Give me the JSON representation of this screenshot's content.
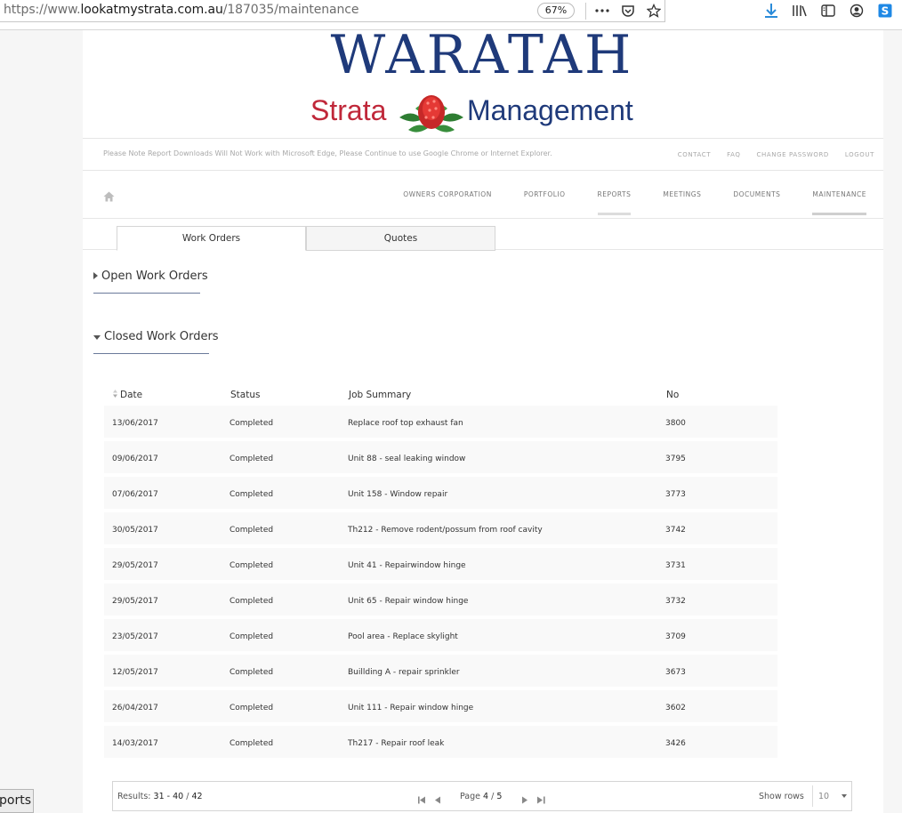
{
  "browser": {
    "url_prefix": "https://www.",
    "url_host": "lookatmystrata.com.au",
    "url_path": "/187035/maintenance",
    "zoom": "67%"
  },
  "logo": {
    "line1": "WARATAH",
    "line2a": "Strata",
    "line2b": "Management"
  },
  "notice": "Please Note Report Downloads Will Not Work with Microsoft Edge, Please Continue to use Google Chrome or Internet Explorer.",
  "toplinks": [
    "CONTACT",
    "FAQ",
    "CHANGE PASSWORD",
    "LOGOUT"
  ],
  "mainnav": [
    "OWNERS CORPORATION",
    "PORTFOLIO",
    "REPORTS",
    "MEETINGS",
    "DOCUMENTS",
    "MAINTENANCE"
  ],
  "tabs": {
    "work": "Work Orders",
    "quotes": "Quotes"
  },
  "sections": {
    "open": "Open Work Orders",
    "closed": "Closed Work Orders"
  },
  "table": {
    "headers": {
      "date": "Date",
      "status": "Status",
      "summary": "Job Summary",
      "no": "No"
    },
    "rows": [
      {
        "date": "13/06/2017",
        "status": "Completed",
        "summary": "Replace roof top exhaust fan",
        "no": "3800"
      },
      {
        "date": "09/06/2017",
        "status": "Completed",
        "summary": "Unit 88 - seal leaking window",
        "no": "3795"
      },
      {
        "date": "07/06/2017",
        "status": "Completed",
        "summary": "Unit 158 - Window repair",
        "no": "3773"
      },
      {
        "date": "30/05/2017",
        "status": "Completed",
        "summary": "Th212 - Remove rodent/possum from roof cavity",
        "no": "3742"
      },
      {
        "date": "29/05/2017",
        "status": "Completed",
        "summary": "Unit 41 - Repairwindow hinge",
        "no": "3731"
      },
      {
        "date": "29/05/2017",
        "status": "Completed",
        "summary": "Unit 65 - Repair window hinge",
        "no": "3732"
      },
      {
        "date": "23/05/2017",
        "status": "Completed",
        "summary": "Pool area - Replace skylight",
        "no": "3709"
      },
      {
        "date": "12/05/2017",
        "status": "Completed",
        "summary": "Buillding A - repair sprinkler",
        "no": "3673"
      },
      {
        "date": "26/04/2017",
        "status": "Completed",
        "summary": "Unit 111 - Repair window hinge",
        "no": "3602"
      },
      {
        "date": "14/03/2017",
        "status": "Completed",
        "summary": "Th217 - Repair roof leak",
        "no": "3426"
      }
    ]
  },
  "pager": {
    "results_label": "Results:",
    "results_range": "31 - 40",
    "results_sep": "/",
    "results_total": "42",
    "page_label": "Page",
    "page_current": "4",
    "page_sep": "/",
    "page_total": "5",
    "show_rows_label": "Show rows",
    "rows_value": "10"
  },
  "side_label": "ports",
  "colors": {
    "brand_blue": "#1f3a7a",
    "brand_red": "#c0283a",
    "download_blue": "#2a8bd9"
  }
}
